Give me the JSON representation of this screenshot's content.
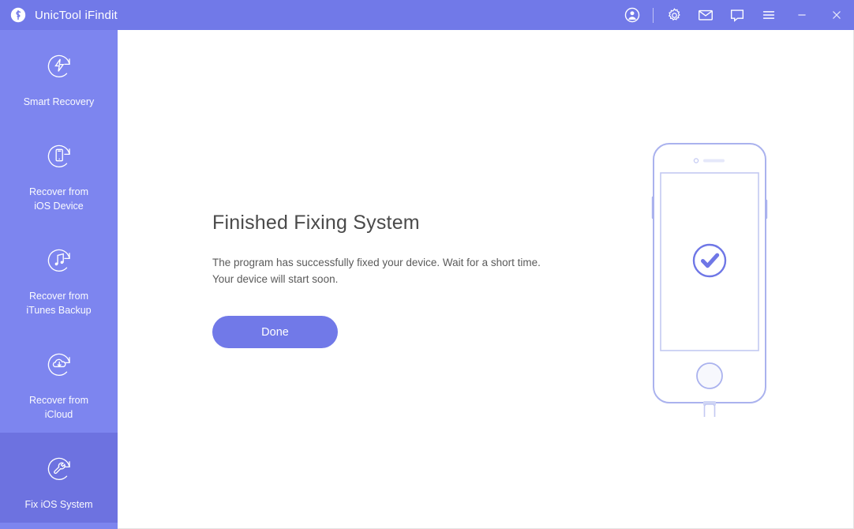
{
  "window": {
    "title": "UnicTool iFindit",
    "logo_icon": "unictool-logo-icon",
    "controls": [
      {
        "name": "account-icon",
        "glyph": "user"
      },
      {
        "name": "settings-icon",
        "glyph": "gear"
      },
      {
        "name": "mail-icon",
        "glyph": "envelope"
      },
      {
        "name": "feedback-icon",
        "glyph": "chat-bubble"
      },
      {
        "name": "menu-icon",
        "glyph": "hamburger"
      },
      {
        "name": "minimize-button",
        "glyph": "minimize"
      },
      {
        "name": "close-button",
        "glyph": "close"
      }
    ]
  },
  "sidebar": {
    "background": "#7d85ef",
    "active_background": "#6d72e0",
    "items": [
      {
        "id": "smart-recovery",
        "label": "Smart Recovery",
        "icon": "bolt-refresh-icon",
        "active": false
      },
      {
        "id": "recover-ios-device",
        "label": "Recover from\niOS Device",
        "icon": "phone-refresh-icon",
        "active": false
      },
      {
        "id": "recover-itunes-backup",
        "label": "Recover from\niTunes Backup",
        "icon": "music-refresh-icon",
        "active": false
      },
      {
        "id": "recover-icloud",
        "label": "Recover from\niCloud",
        "icon": "cloud-refresh-icon",
        "active": false
      },
      {
        "id": "fix-ios-system",
        "label": "Fix iOS System",
        "icon": "wrench-refresh-icon",
        "active": true
      }
    ]
  },
  "main": {
    "headline": "Finished Fixing System",
    "description": "The program has successfully fixed your device. Wait for a short time.\nYour device will start soon.",
    "primary_button": "Done",
    "illustration": {
      "name": "iphone-success-illustration",
      "status_icon": "check-circle-icon",
      "accent_color": "#7179e8",
      "outline_color": "#b9bff0"
    }
  },
  "colors": {
    "brand_purple": "#7179e8",
    "sidebar_purple": "#7d85ef",
    "sidebar_active": "#6d72e0",
    "text_dark": "#4a4a4a",
    "text_body": "#5a5a5a"
  }
}
